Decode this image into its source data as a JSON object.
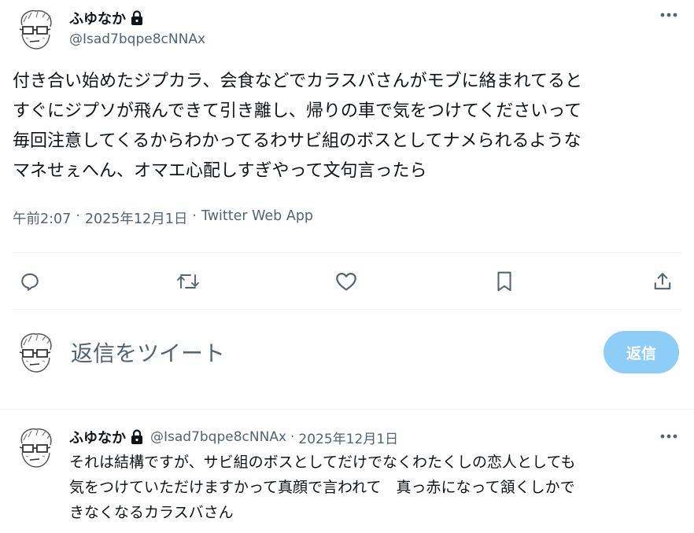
{
  "tweet": {
    "display_name": "ふゆなか",
    "handle": "@Isad7bqpe8cNNAx",
    "text_lines": [
      "付き合い始めたジプカラ、会食などでカラスバさんがモブに絡まれてると",
      "すぐにジプソが飛んできて引き離し、帰りの車で気をつけてくださいって",
      "毎回注意してくるからわかってるわサビ組のボスとしてナメられるような",
      "マネせぇへん、オマエ心配しすぎやって文句言ったら"
    ],
    "time": "午前2:07",
    "date": "2025年12月1日",
    "separator": "·",
    "source": "Twitter Web App",
    "icons": {
      "lock": "lock-icon",
      "more": "more-icon",
      "reply": "reply-icon",
      "retweet": "retweet-icon",
      "like": "heart-icon",
      "bookmark": "bookmark-icon",
      "share": "share-icon"
    }
  },
  "composer": {
    "placeholder": "返信をツイート",
    "button_label": "返信"
  },
  "reply": {
    "display_name": "ふゆなか",
    "handle": "@Isad7bqpe8cNNAx",
    "separator": "·",
    "date": "2025年12月1日",
    "text_lines": [
      "それは結構ですが、サビ組のボスとしてだけでなくわたくしの恋人としても",
      "気をつけていただけますかって真顔で言われて　真っ赤になって頷くしかで",
      "きなくなるカラスバさん"
    ]
  },
  "colors": {
    "text_primary": "#0f1419",
    "text_secondary": "#536471",
    "divider": "#eff3f4",
    "reply_button_bg": "#8ecdf8"
  }
}
